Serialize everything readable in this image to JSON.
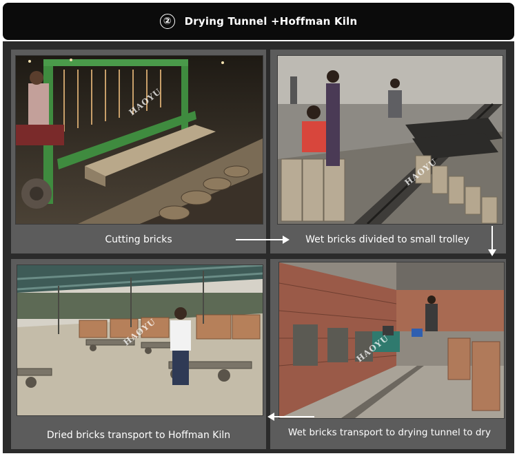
{
  "header": {
    "step_number": "②",
    "title": "Drying Tunnel +Hoffman Kiln"
  },
  "watermark": "HAOYU",
  "panels": {
    "cutting": {
      "caption": "Cutting bricks"
    },
    "wet_trolley": {
      "caption": "Wet bricks divided to small trolley"
    },
    "transport_tunnel": {
      "caption": "Wet bricks transport to drying tunnel to dry"
    },
    "dried_kiln": {
      "caption": "Dried bricks transport to Hoffman Kiln"
    }
  },
  "colors": {
    "header_bg": "#0b0b0b",
    "stage_bg": "#2b2b2b",
    "panel_bg": "#5c5c5c",
    "arrow": "#ffffff"
  }
}
